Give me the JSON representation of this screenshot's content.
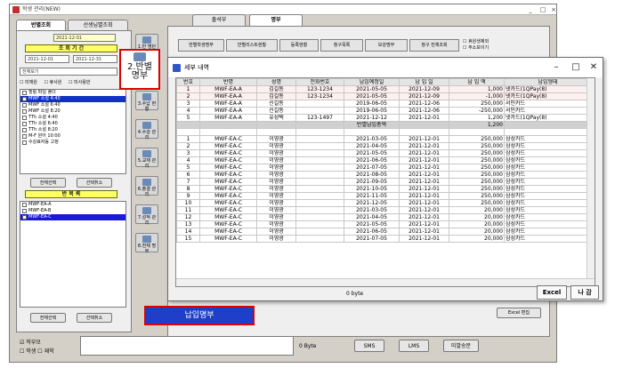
{
  "app": {
    "title": "학생 관리(NEW)",
    "tabs": [
      "반별조회",
      "선생님별조회"
    ],
    "date_from": "2021-12-01",
    "date_to": "2021-12-31",
    "date_range_label": "조 회 기 간",
    "month_from": "2021-12-01",
    "month_to": "2021-12-31",
    "view_select": "전체보기",
    "checkboxes": [
      "미재원",
      "휴사원",
      "미사용반"
    ],
    "class_list": [
      "힐링 파일 폴더",
      "MWF 소설 4:40",
      "MWF 소설 6:40",
      "MWF 소설 8:20",
      "TTh 소설 4:40",
      "TTh 소설 6:40",
      "TTh 소설 8:20",
      "M-F 원어 10:00",
      "수강료자동 고정"
    ],
    "select_all": "전체선택",
    "deselect_all": "선택취소",
    "group_label": "반 목 록",
    "group_list": [
      "MWF-EA-A",
      "MWF-EA-B",
      "MWF-EA-C"
    ],
    "select_all_2": "전체선택",
    "deselect_all_2": "선택취소",
    "vertical_tools": [
      "1.반 명단",
      "2.반별 명부",
      "3.수납 현황",
      "4.수강 관리",
      "5.교재 관리",
      "6.출결 관리",
      "7.성적 관리",
      "8.전체 명부"
    ],
    "top_tab_labels": [
      "출석부",
      "명부"
    ],
    "top_buttons": [
      "반별학생명부",
      "반별리스트현황",
      "등록현황",
      "청구목록",
      "보강명부",
      "청구 전체조회"
    ],
    "options": [
      "휴원생제외",
      "주소보이기"
    ],
    "excel_edit": "Excel 편집",
    "callout_label": "2.반별\n명부",
    "caption": "납입명부",
    "footer_checks": [
      "학부모",
      "학생",
      "재학"
    ],
    "bytes": "0 Byte",
    "footer_buttons": [
      "SMS",
      "LMS",
      "미발송문"
    ]
  },
  "dialog": {
    "title": "세부 내역",
    "columns": [
      "번호",
      "반명",
      "성명",
      "전화번호",
      "납입예정일",
      "납 입 일",
      "납 입 액",
      "납입형태"
    ],
    "rows": [
      [
        "1",
        "MWF-EA-A",
        "김길동",
        "123-1234",
        "2021-05-05",
        "2021-12-09",
        "1,000",
        "넷카드(1QPay(8)"
      ],
      [
        "2",
        "MWF-EA-A",
        "김길동",
        "123-1234",
        "2021-05-05",
        "2021-12-09",
        "-1,000",
        "넷카드(1QPay(8)"
      ],
      [
        "3",
        "MWF-EA-A",
        "신길동",
        "",
        "2019-06-05",
        "2021-12-06",
        "250,000",
        "서민카드"
      ],
      [
        "4",
        "MWF-EA-A",
        "신길동",
        "",
        "2019-06-05",
        "2021-12-06",
        "-250,000",
        "서민카드"
      ],
      [
        "5",
        "MWF-EA-A",
        "유성택",
        "123-1497",
        "2021-12-12",
        "2021-12-01",
        "1,200",
        "넷카드(1QPay(8)"
      ],
      [
        "",
        "",
        "",
        "",
        "반별납입총액",
        "",
        "1,200",
        ""
      ],
      [
        "",
        "",
        "",
        "",
        "",
        "",
        "",
        ""
      ],
      [
        "1",
        "MWF-EA-C",
        "이영광",
        "",
        "2021-03-05",
        "2021-12-01",
        "250,000",
        "삼성카드"
      ],
      [
        "2",
        "MWF-EA-C",
        "이영광",
        "",
        "2021-04-05",
        "2021-12-01",
        "250,000",
        "삼성카드"
      ],
      [
        "3",
        "MWF-EA-C",
        "이영광",
        "",
        "2021-05-05",
        "2021-12-01",
        "250,000",
        "삼성카드"
      ],
      [
        "4",
        "MWF-EA-C",
        "이영광",
        "",
        "2021-06-05",
        "2021-12-01",
        "250,000",
        "삼성카드"
      ],
      [
        "5",
        "MWF-EA-C",
        "이영광",
        "",
        "2021-07-05",
        "2021-12-01",
        "250,000",
        "삼성카드"
      ],
      [
        "6",
        "MWF-EA-C",
        "이영광",
        "",
        "2021-08-05",
        "2021-12-01",
        "250,000",
        "삼성카드"
      ],
      [
        "7",
        "MWF-EA-C",
        "이영광",
        "",
        "2021-09-05",
        "2021-12-01",
        "250,000",
        "삼성카드"
      ],
      [
        "8",
        "MWF-EA-C",
        "이영광",
        "",
        "2021-10-05",
        "2021-12-01",
        "250,000",
        "삼성카드"
      ],
      [
        "9",
        "MWF-EA-C",
        "이영광",
        "",
        "2021-11-05",
        "2021-12-01",
        "250,000",
        "삼성카드"
      ],
      [
        "10",
        "MWF-EA-C",
        "이영광",
        "",
        "2021-12-05",
        "2021-12-01",
        "250,000",
        "삼성카드"
      ],
      [
        "11",
        "MWF-EA-C",
        "이영광",
        "",
        "2021-03-05",
        "2021-12-01",
        "20,000",
        "삼성카드"
      ],
      [
        "12",
        "MWF-EA-C",
        "이영광",
        "",
        "2021-04-05",
        "2021-12-01",
        "20,000",
        "삼성카드"
      ],
      [
        "13",
        "MWF-EA-C",
        "이영광",
        "",
        "2021-05-05",
        "2021-12-01",
        "20,000",
        "삼성카드"
      ],
      [
        "14",
        "MWF-EA-C",
        "이영광",
        "",
        "2021-06-05",
        "2021-12-01",
        "20,000",
        "삼성카드"
      ],
      [
        "15",
        "MWF-EA-C",
        "이영광",
        "",
        "2021-07-05",
        "2021-12-01",
        "20,000",
        "삼성카드"
      ]
    ],
    "bytes": "0 byte",
    "excel_button": "Excel",
    "close_button": "나 감"
  }
}
